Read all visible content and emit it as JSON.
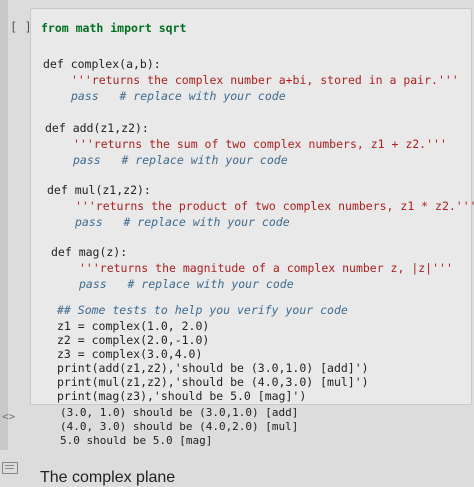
{
  "cell": {
    "prompt": "[ ]",
    "lines": [
      "from math import sqrt",
      "def complex(a,b):",
      "'''returns the complex number a+bi, stored in a pair.'''",
      "pass   # replace with your code",
      "def add(z1,z2):",
      "'''returns the sum of two complex numbers, z1 + z2.'''",
      "pass   # replace with your code",
      "def mul(z1,z2):",
      "'''returns the product of two complex numbers, z1 * z2.'''",
      "pass   # replace with your code",
      "def mag(z):",
      "'''returns the magnitude of a complex number z, |z|'''",
      "pass   # replace with your code",
      "## Some tests to help you verify your code",
      "z1 = complex(1.0, 2.0)",
      "z2 = complex(2.0,-1.0)",
      "z3 = complex(3.0,4.0)",
      "print(add(z1,z2),'should be (3.0,1.0) [add]')",
      "print(mul(z1,z2),'should be (4.0,3.0) [mul]')",
      "print(mag(z3),'should be 5.0 [mag]')"
    ]
  },
  "output": {
    "prompt": "<>",
    "lines": [
      "(3.0, 1.0) should be (3.0,1.0) [add]",
      "(4.0, 3.0) should be (4.0,2.0) [mul]",
      "5.0 should be 5.0 [mag]"
    ]
  },
  "markdown": {
    "title": "The complex plane"
  }
}
